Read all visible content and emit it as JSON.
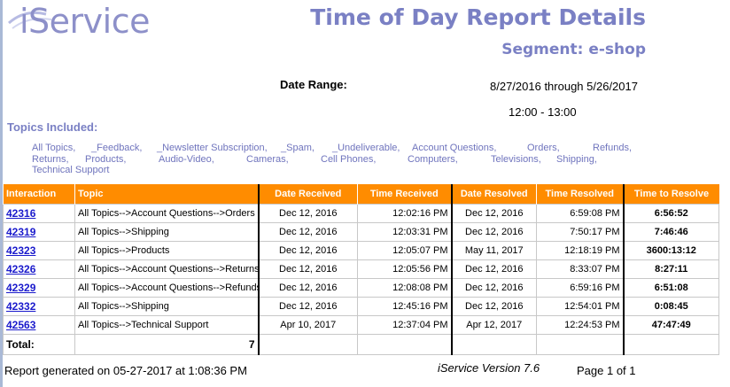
{
  "logo": {
    "text": "iService"
  },
  "title": "Time of Day Report Details",
  "segment": "Segment: e-shop",
  "date_range": {
    "label": "Date Range:",
    "value": "8/27/2016 through 5/26/2017",
    "time": "12:00 - 13:00"
  },
  "topics": {
    "heading": "Topics Included:",
    "items": [
      "All Topics,",
      "_Feedback,",
      "_Newsletter Subscription,",
      "_Spam,",
      "_Undeliverable,",
      "Account Questions,",
      "Orders,",
      "Refunds,",
      "Returns,",
      "Products,",
      "Audio-Video,",
      "Cameras,",
      "Cell Phones,",
      "Computers,",
      "Televisions,",
      "Shipping,",
      "Technical Support"
    ]
  },
  "table": {
    "headers": [
      "Interaction",
      "Topic",
      "Date Received",
      "Time Received",
      "Date Resolved",
      "Time Resolved",
      "Time to Resolve"
    ],
    "rows": [
      [
        "42316",
        "All Topics-->Account Questions-->Orders",
        "Dec 12, 2016",
        "12:02:16 PM",
        "Dec 12, 2016",
        "6:59:08 PM",
        "6:56:52"
      ],
      [
        "42319",
        "All Topics-->Shipping",
        "Dec 12, 2016",
        "12:03:31 PM",
        "Dec 12, 2016",
        "7:50:17 PM",
        "7:46:46"
      ],
      [
        "42323",
        "All Topics-->Products",
        "Dec 12, 2016",
        "12:05:07 PM",
        "May 11, 2017",
        "12:18:19 PM",
        "3600:13:12"
      ],
      [
        "42326",
        "All Topics-->Account Questions-->Returns",
        "Dec 12, 2016",
        "12:05:56 PM",
        "Dec 12, 2016",
        "8:33:07 PM",
        "8:27:11"
      ],
      [
        "42329",
        "All Topics-->Account Questions-->Refunds",
        "Dec 12, 2016",
        "12:08:08 PM",
        "Dec 12, 2016",
        "6:59:16 PM",
        "6:51:08"
      ],
      [
        "42332",
        "All Topics-->Shipping",
        "Dec 12, 2016",
        "12:45:16 PM",
        "Dec 12, 2016",
        "12:54:01 PM",
        "0:08:45"
      ],
      [
        "42563",
        "All Topics-->Technical Support",
        "Apr 10, 2017",
        "12:37:04 PM",
        "Apr 12, 2017",
        "12:24:53 PM",
        "47:47:49"
      ]
    ],
    "total_label": "Total:",
    "total_count": "7"
  },
  "footer": {
    "generated": "Report generated on 05-27-2017 at 1:08:36 PM",
    "version": "iService Version 7.6",
    "page": "Page 1 of 1"
  },
  "colors": {
    "header_orange": "#ff8c00",
    "title_purple": "#7a80c4",
    "link_blue": "#1a1acc"
  }
}
